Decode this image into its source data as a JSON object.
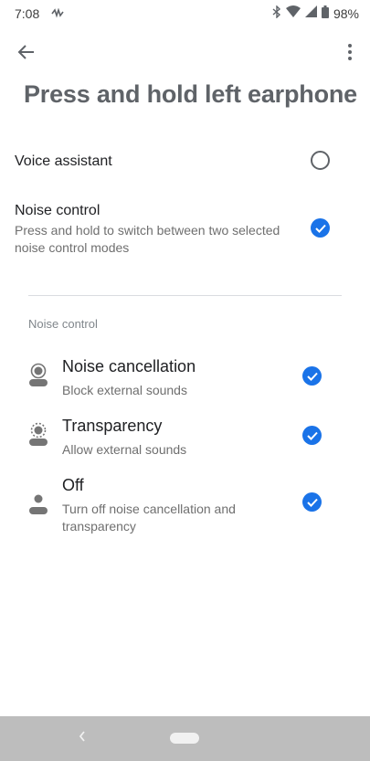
{
  "status": {
    "time": "7:08",
    "battery": "98%"
  },
  "header": {
    "title": "Press and hold left earphone"
  },
  "options": {
    "voice_assistant": {
      "label": "Voice assistant",
      "selected": false
    },
    "noise_control": {
      "label": "Noise control",
      "description": "Press and hold to switch between two selected noise control modes",
      "selected": true
    }
  },
  "noise_section": {
    "heading": "Noise control",
    "modes": [
      {
        "title": "Noise cancellation",
        "subtitle": "Block external sounds",
        "checked": true
      },
      {
        "title": "Transparency",
        "subtitle": "Allow external sounds",
        "checked": true
      },
      {
        "title": "Off",
        "subtitle": "Turn off noise cancellation and transparency",
        "checked": true
      }
    ]
  },
  "colors": {
    "accent": "#1a73e8",
    "title_gray": "#5f6368",
    "nav_bar": "#bdbdbd"
  },
  "icons": {
    "back": "arrow-left-icon",
    "more": "more-vert-icon",
    "check": "check-circle-icon",
    "radio": "radio-unchecked-icon",
    "mode": "person-ear-icon"
  }
}
